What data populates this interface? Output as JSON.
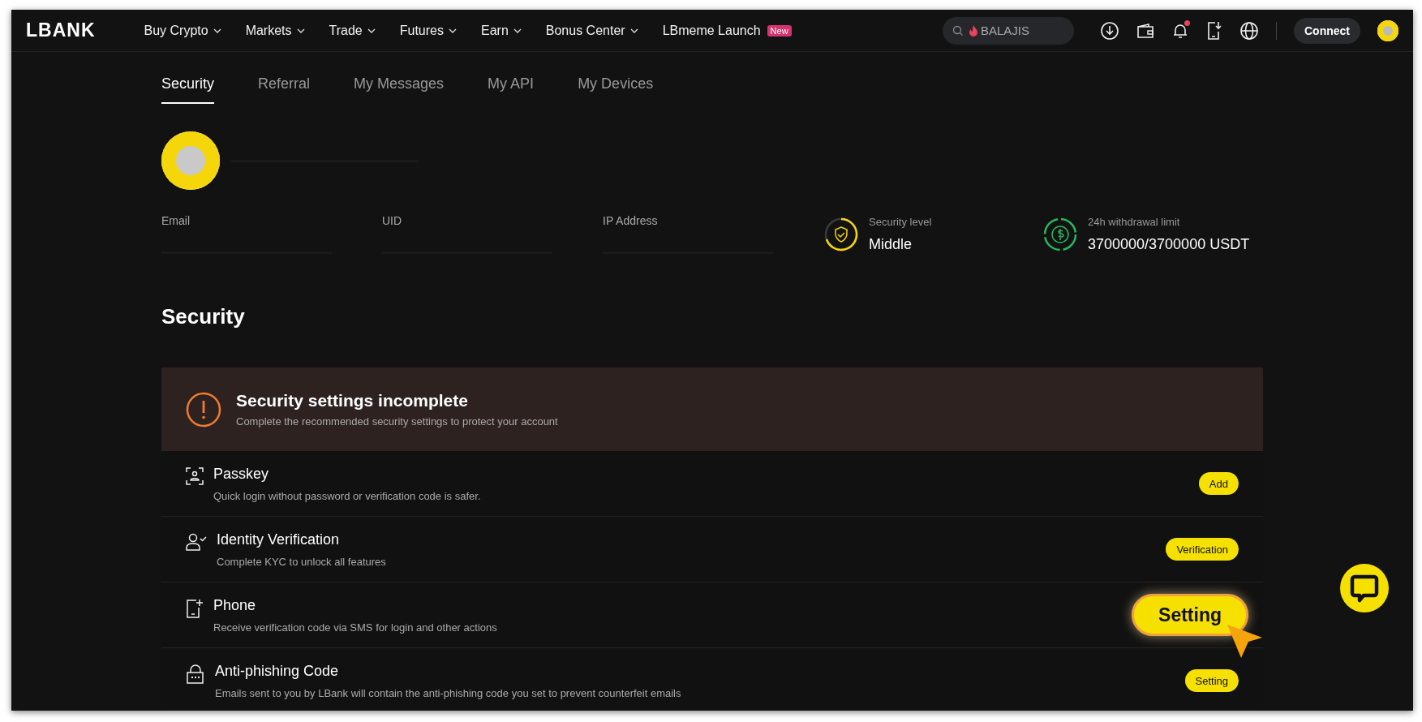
{
  "header": {
    "logo": "LBANK",
    "nav": [
      {
        "label": "Buy Crypto",
        "dropdown": true
      },
      {
        "label": "Markets",
        "dropdown": true
      },
      {
        "label": "Trade",
        "dropdown": true
      },
      {
        "label": "Futures",
        "dropdown": true
      },
      {
        "label": "Earn",
        "dropdown": true
      },
      {
        "label": "Bonus Center",
        "dropdown": true
      },
      {
        "label": "LBmeme Launch",
        "dropdown": false,
        "badge": "New"
      }
    ],
    "search": {
      "placeholder": "BALAJIS"
    },
    "notifications_unread": true,
    "connect_button": "Connect"
  },
  "tabs": [
    {
      "label": "Security",
      "selected": true
    },
    {
      "label": "Referral",
      "selected": false
    },
    {
      "label": "My Messages",
      "selected": false
    },
    {
      "label": "My API",
      "selected": false
    },
    {
      "label": "My Devices",
      "selected": false
    }
  ],
  "profile": {
    "fields": [
      {
        "label": "Email"
      },
      {
        "label": "UID"
      },
      {
        "label": "IP Address"
      }
    ],
    "security_level": {
      "label": "Security level",
      "value": "Middle"
    },
    "withdrawal_limit": {
      "label": "24h withdrawal limit",
      "value": "3700000/3700000 USDT"
    }
  },
  "section_title": "Security",
  "alert": {
    "title": "Security settings incomplete",
    "message": "Complete the recommended security settings to protect your account"
  },
  "settings": [
    {
      "kind": "passkey",
      "title": "Passkey",
      "description": "Quick login without password or verification code is safer.",
      "action": "Add",
      "highlighted": false
    },
    {
      "kind": "identity",
      "title": "Identity Verification",
      "description": "Complete KYC to unlock all features",
      "action": "Verification",
      "highlighted": false
    },
    {
      "kind": "phone",
      "title": "Phone",
      "description": "Receive verification code via SMS for login and other actions",
      "action": "Setting",
      "highlighted": true
    },
    {
      "kind": "antiphishing",
      "title": "Anti-phishing Code",
      "description": "Emails sent to you by LBank will contain the anti-phishing code you set to prevent counterfeit emails",
      "action": "Setting",
      "highlighted": false
    }
  ]
}
